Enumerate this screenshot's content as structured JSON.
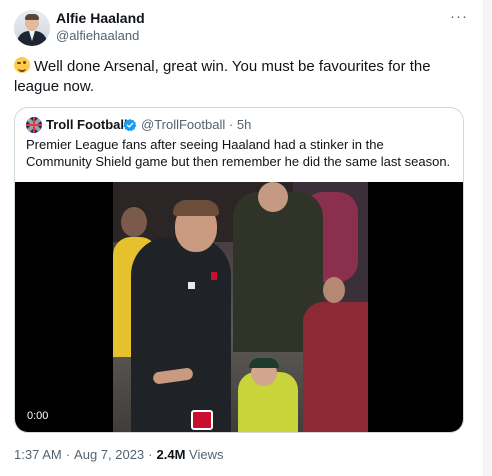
{
  "tweet": {
    "author_name": "Alfie Haaland",
    "author_handle": "@alfiehaaland",
    "more_icon": "ellipsis-icon",
    "text": "Well done Arsenal, great win. You must be favourites for the league now.",
    "emoji": "winking-face-emoji"
  },
  "quoted": {
    "author_name": "Troll Football",
    "verified_icon": "verified-badge-icon",
    "author_handle": "@TrollFootball",
    "separator": "·",
    "time": "5h",
    "text": "Premier League fans after seeing Haaland had a stinker in the Community Shield game but then remember he did the same last season.",
    "video": {
      "timecode": "0:00"
    }
  },
  "meta": {
    "time": "1:37 AM",
    "dot": "·",
    "date": "Aug 7, 2023",
    "views_count": "2.4M",
    "views_label": "Views"
  },
  "colors": {
    "text": "#0f1419",
    "secondary": "#536471",
    "border": "#cfd9de",
    "verified": "#1d9bf0"
  }
}
